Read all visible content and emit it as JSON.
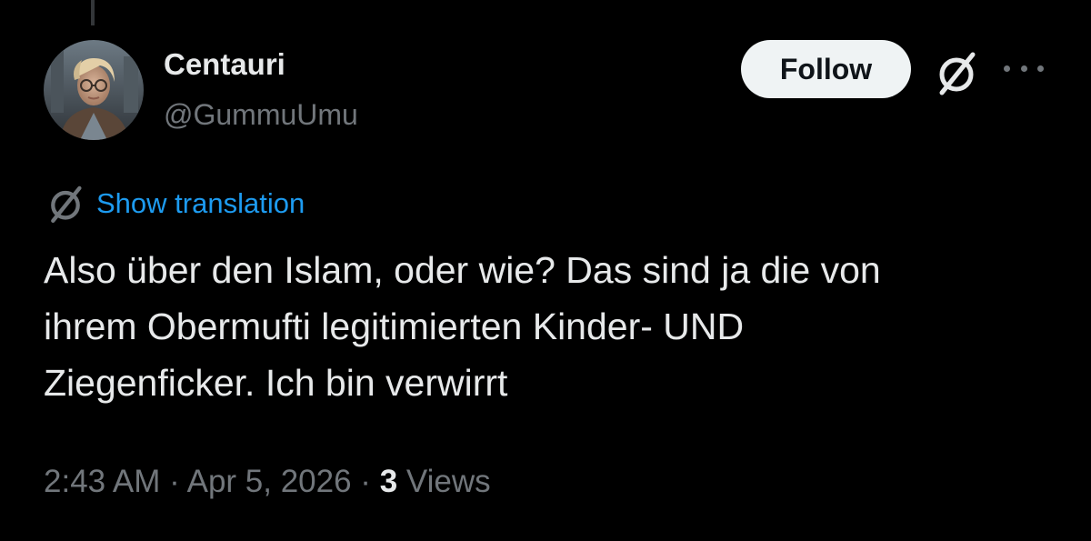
{
  "user": {
    "display_name": "Centauri",
    "handle": "@GummuUmu"
  },
  "actions": {
    "follow_label": "Follow",
    "grok_icon": "grok-icon",
    "more_icon": "more-icon"
  },
  "translation": {
    "label": "Show translation"
  },
  "tweet": {
    "lines": [
      "Also über den Islam, oder wie? Das sind ja die von",
      "ihrem Obermufti legitimierten Kinder- UND",
      "Ziegenficker. Ich bin verwirrt"
    ]
  },
  "meta": {
    "time": "2:43 AM",
    "separator": " · ",
    "date": "Apr 5, 2026",
    "views_count": "3",
    "views_label": " Views"
  },
  "colors": {
    "background": "#000000",
    "text": "#e7e9ea",
    "secondary": "#71767b",
    "link": "#1d9bf0",
    "follow_bg": "#eff3f4"
  }
}
